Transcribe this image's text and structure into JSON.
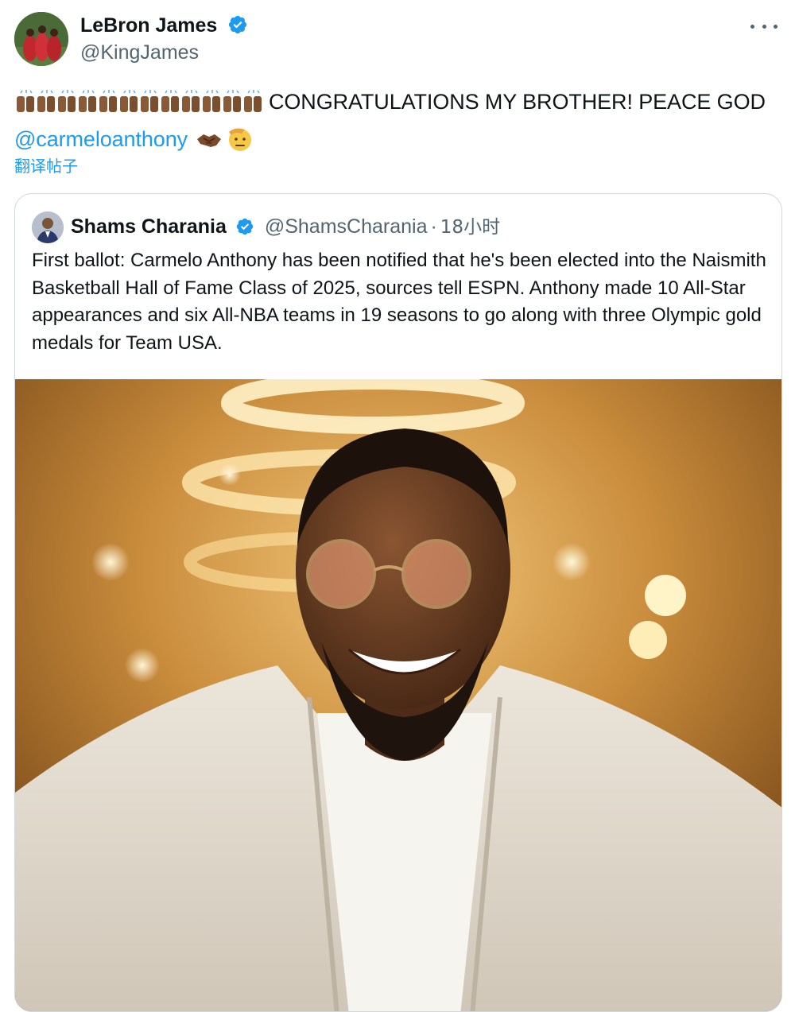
{
  "colors": {
    "link": "#1d9bf0",
    "verified": "#1d9bf0",
    "secondary": "#536471",
    "border": "#cfd9de"
  },
  "post": {
    "author": {
      "name": "LeBron James",
      "handle": "@KingJames",
      "verified_icon": "verified-badge-icon",
      "avatar_icon": "avatar-photo"
    },
    "text_main": "CONGRATULATIONS MY BROTHER! PEACE GOD",
    "mention": "@carmeloanthony",
    "emoji_clap_count": 12,
    "emoji_icons": [
      "raising-hands-icon",
      "handshake-icon",
      "saluting-face-icon"
    ],
    "translate_label": "翻译帖子",
    "more_icon": "more-options-icon"
  },
  "quote": {
    "author": {
      "name": "Shams Charania",
      "handle": "@ShamsCharania",
      "verified_icon": "verified-badge-icon"
    },
    "separator": "·",
    "time": "18小时",
    "text": "First ballot: Carmelo Anthony has been notified that he's been elected into the Naismith Basketball Hall of Fame Class of 2025, sources tell ESPN. Anthony made 10 All-Star appearances and six All-NBA teams in 19 seasons to go along with three Olympic gold medals for Team USA.",
    "media_icon": "photo-smiling-man-icon"
  }
}
